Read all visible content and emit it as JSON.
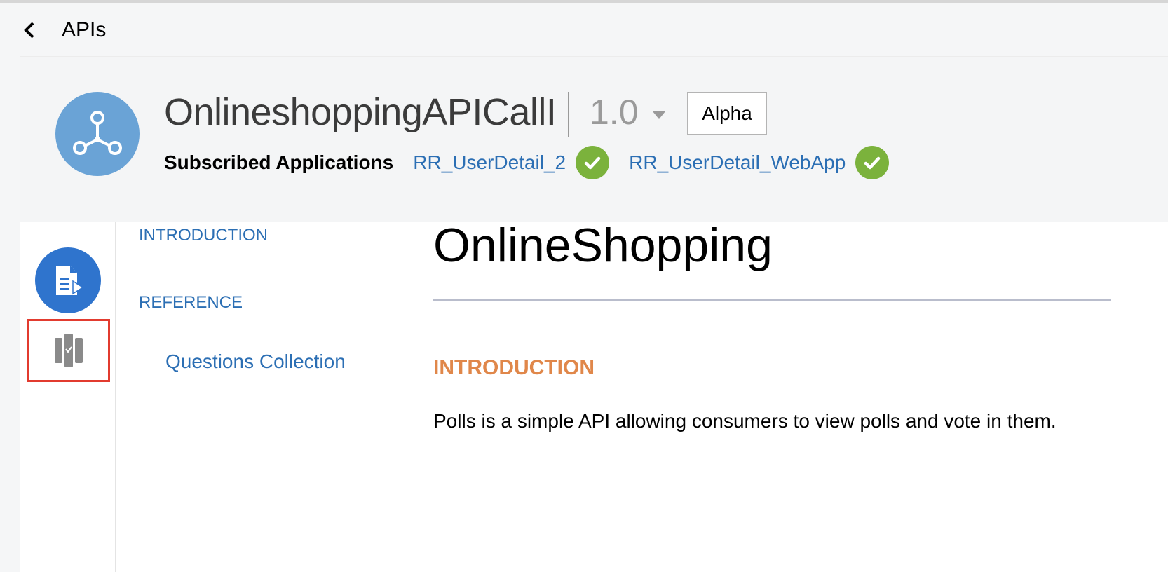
{
  "nav": {
    "back_label": "APIs"
  },
  "api": {
    "name": "OnlineshoppingAPICallI",
    "version": "1.0",
    "stage": "Alpha",
    "logo_icon": "api-network-icon"
  },
  "subscriptions": {
    "label": "Subscribed Applications",
    "apps": [
      {
        "name": "RR_UserDetail_2",
        "status_icon": "check-circle-icon"
      },
      {
        "name": "RR_UserDetail_WebApp",
        "status_icon": "check-circle-icon"
      }
    ]
  },
  "rail": {
    "items": [
      {
        "icon": "documentation-icon",
        "active": true
      },
      {
        "icon": "test-console-icon",
        "highlighted": true
      }
    ]
  },
  "toc": {
    "introduction": "INTRODUCTION",
    "reference": "REFERENCE",
    "questions": "Questions Collection"
  },
  "doc": {
    "title": "OnlineShopping",
    "section_heading": "INTRODUCTION",
    "intro_text": "Polls is a simple API allowing consumers to view polls and vote in them."
  },
  "colors": {
    "link": "#2c6fb4",
    "accent_orange": "#e0874a",
    "check_green": "#7bb23c",
    "rail_active_blue": "#2f74cd",
    "highlight_red": "#e23b2f"
  }
}
